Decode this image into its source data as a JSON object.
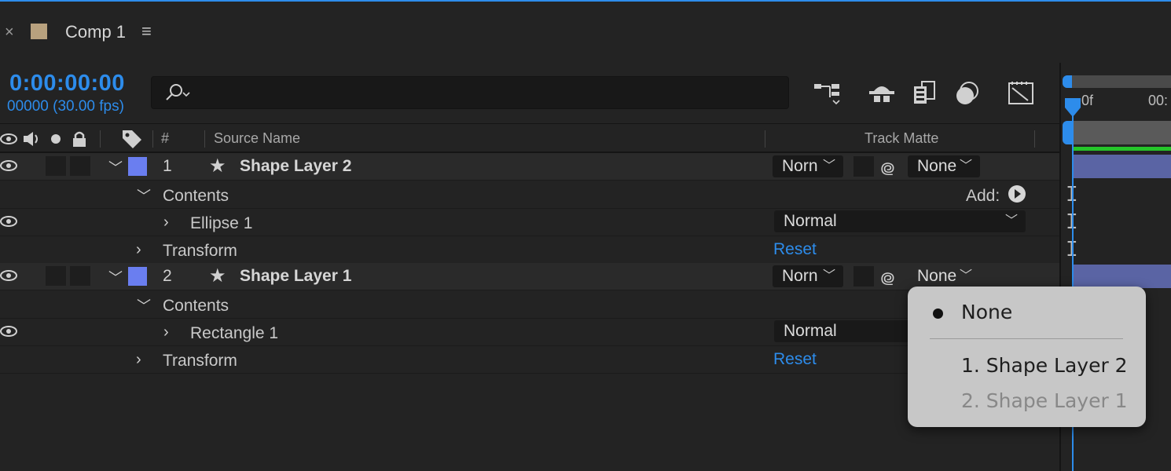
{
  "tab": {
    "close": "×",
    "title": "Comp 1",
    "menu": "≡"
  },
  "time": {
    "timecode": "0:00:00:00",
    "frames": "00000 (30.00 fps)"
  },
  "timeline": {
    "ruler_start": "0f",
    "ruler_next": "00:",
    "ibeam": "I"
  },
  "columns": {
    "hash": "#",
    "source_name": "Source Name",
    "track_matte": "Track Matte"
  },
  "layers": [
    {
      "number": "1",
      "name": "Shape Layer 2",
      "mode": "Norn",
      "matte": "None",
      "contents_label": "Contents",
      "add_label": "Add:",
      "child_label": "Ellipse 1",
      "child_mode": "Normal",
      "transform_label": "Transform",
      "reset_label": "Reset"
    },
    {
      "number": "2",
      "name": "Shape Layer 1",
      "mode": "Norn",
      "matte": "None",
      "contents_label": "Contents",
      "child_label": "Rectangle 1",
      "child_mode": "Normal",
      "transform_label": "Transform",
      "reset_label": "Reset"
    }
  ],
  "popup": {
    "items": [
      {
        "label": "None",
        "selected": true,
        "enabled": true
      },
      {
        "label": "1. Shape Layer 2",
        "selected": false,
        "enabled": true
      },
      {
        "label": "2. Shape Layer 1",
        "selected": false,
        "enabled": false
      }
    ]
  },
  "colors": {
    "accent": "#2d8ceb",
    "label": "#6a7ef0",
    "layer_bar": "#5a64a4",
    "work_area": "#25c52a"
  }
}
